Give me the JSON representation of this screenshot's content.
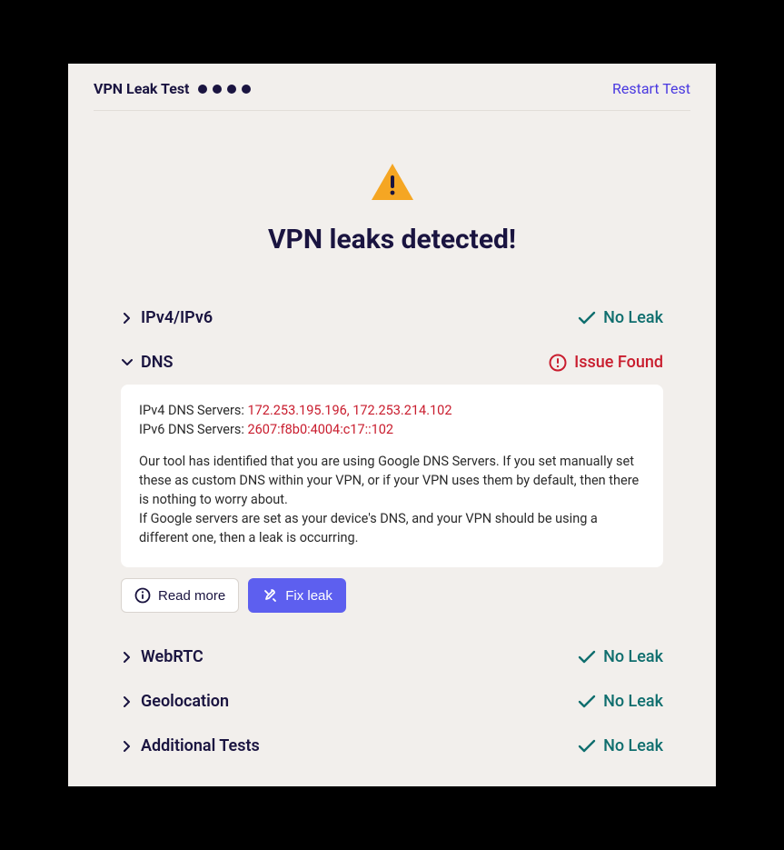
{
  "header": {
    "title": "VPN Leak Test",
    "restart_label": "Restart Test"
  },
  "hero": {
    "title": "VPN leaks detected!"
  },
  "status_labels": {
    "ok": "No Leak",
    "bad": "Issue Found"
  },
  "sections": [
    {
      "name": "IPv4/IPv6",
      "status": "ok",
      "expanded": false
    },
    {
      "name": "DNS",
      "status": "bad",
      "expanded": true
    },
    {
      "name": "WebRTC",
      "status": "ok",
      "expanded": false
    },
    {
      "name": "Geolocation",
      "status": "ok",
      "expanded": false
    },
    {
      "name": "Additional Tests",
      "status": "ok",
      "expanded": false
    }
  ],
  "dns_panel": {
    "ipv4_label": "IPv4 DNS Servers: ",
    "ipv4_value": "172.253.195.196, 172.253.214.102",
    "ipv6_label": "IPv6 DNS Servers: ",
    "ipv6_value": "2607:f8b0:4004:c17::102",
    "para1": "Our tool has identified that you are using Google DNS Servers. If you set manually set these as custom DNS within your VPN, or if your VPN uses them by default, then there is nothing to worry about.",
    "para2": "If Google servers are set as your device's DNS, and your VPN should be using a different one, then a leak is occurring.",
    "read_more_label": "Read more",
    "fix_leak_label": "Fix leak"
  }
}
